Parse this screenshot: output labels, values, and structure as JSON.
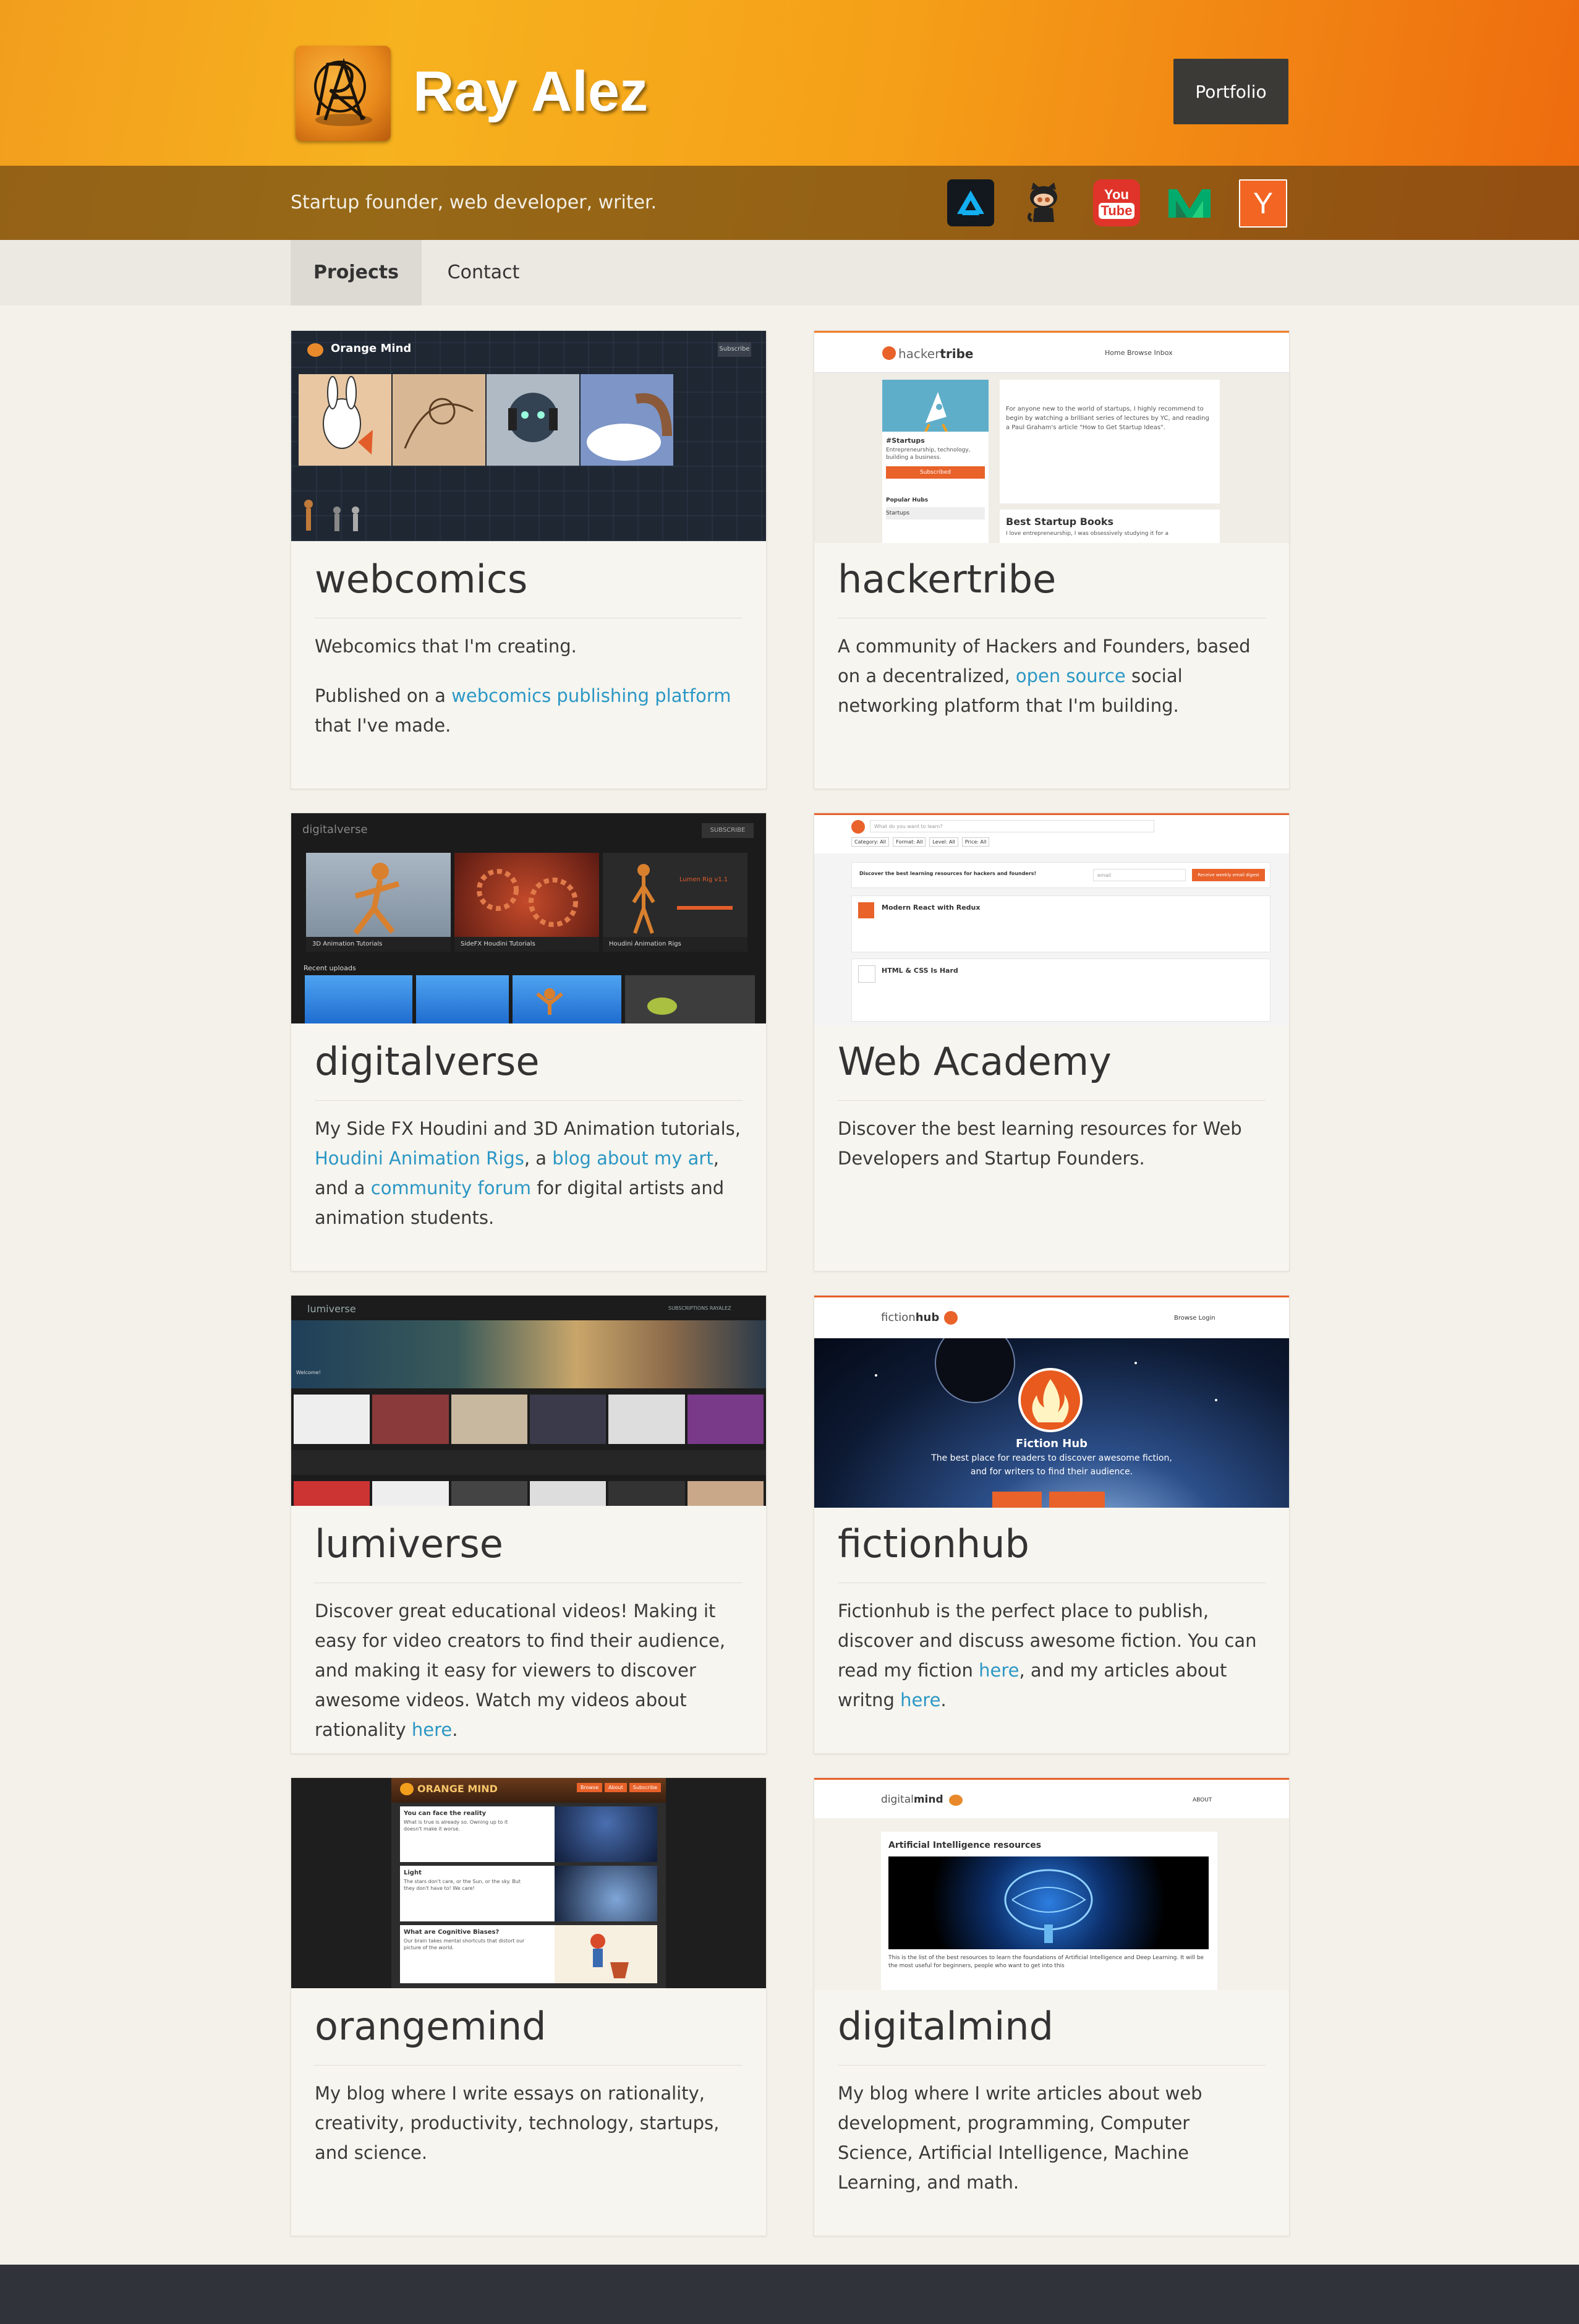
{
  "header": {
    "brand": "Ray Alez",
    "portfolio_label": "Portfolio",
    "tagline": "Startup founder, web developer, writer.",
    "social": [
      "artstation-icon",
      "github-icon",
      "youtube-icon",
      "medium-icon",
      "hacker-news-icon"
    ],
    "youtube_text": [
      "You",
      "Tube"
    ],
    "hn_letter": "Y"
  },
  "nav": {
    "projects": "Projects",
    "contact": "Contact"
  },
  "cards": {
    "webcomics": {
      "title": "webcomics",
      "p1": "Webcomics that I'm creating.",
      "p2_pre": "Published on a ",
      "p2_link": "webcomics publishing platform",
      "p2_post": " that I've made.",
      "shot": {
        "brand": "Orange Mind",
        "button": "Subscribe"
      }
    },
    "hackertribe": {
      "title": "hackertribe",
      "p1_pre": "A community of Hackers and Founders, based on a decentralized, ",
      "p1_link": "open source",
      "p1_post": " social networking platform that I'm building.",
      "shot": {
        "brand_a": "hacker",
        "brand_b": "tribe",
        "nav": "Home  Browse  Inbox",
        "hub": "#Startups",
        "hub_desc": "Entrepreneurship, technology, building a business.",
        "subscribe": "Subscribed",
        "popular": "Popular Hubs",
        "popular_item": "Startups",
        "post_title": "Best Startup Books",
        "post_text": "I love entrepreneurship, I was obsessively studying it for a",
        "intro": "For anyone new to the world of startups, I highly recommend to begin by watching a brilliant series of lectures by YC, and reading a Paul Graham's article \"How to Get Startup Ideas\"."
      }
    },
    "digitalverse": {
      "title": "digitalverse",
      "p1_pre": "My Side FX Houdini and 3D Animation tutorials, ",
      "link1": "Houdini Animation Rigs",
      "mid1": ", a ",
      "link2": "blog about my art",
      "mid2": ", and a ",
      "link3": "community forum",
      "p1_post": " for digital artists and animation students.",
      "shot": {
        "brand": "digitalverse",
        "button": "SUBSCRIBE",
        "thumbs": [
          "3D Animation Tutorials",
          "SideFX Houdini Tutorials",
          "Houdini Animation Rigs"
        ],
        "recent": "Recent uploads",
        "promo": "Lumen Rig v1.1"
      }
    },
    "webacademy": {
      "title": "Web Academy",
      "p1": "Discover the best learning resources for Web Developers and Startup Founders.",
      "shot": {
        "search": "What do you want to learn?",
        "filters": [
          "Category: All",
          "Format: All",
          "Level: All",
          "Price: All"
        ],
        "banner": "Discover the best learning resources for hackers and founders!",
        "email": "email",
        "cta": "Receive weekly email digest",
        "items": [
          "Modern React with Redux",
          "HTML & CSS Is Hard"
        ]
      }
    },
    "lumiverse": {
      "title": "lumiverse",
      "p1_pre": "Discover great educational videos! Making it easy for video creators to find their audience, and making it easy for viewers to discover awesome videos. Watch my videos about rationality ",
      "p1_link": "here",
      "p1_post": ".",
      "shot": {
        "brand": "lumiverse",
        "nav": "SUBSCRIPTIONS  RAYALEZ",
        "welcome": "Welcome!"
      }
    },
    "fictionhub": {
      "title": "fictionhub",
      "p1_pre": "Fictionhub is the perfect place to publish, discover and discuss awesome fiction. You can read my fiction ",
      "link1": "here",
      "mid": ", and my articles about writng ",
      "link2": "here",
      "p1_post": ".",
      "shot": {
        "brand_a": "fiction",
        "brand_b": "hub",
        "nav": "Browse  Login",
        "hero_title": "Fiction Hub",
        "hero_line1": "The best place for readers to discover awesome fiction,",
        "hero_line2": "and for writers to find their audience."
      }
    },
    "orangemind": {
      "title": "orangemind",
      "p1": "My blog where I write essays on rationality, creativity, productivity, technology, startups, and science.",
      "shot": {
        "brand": "ORANGE MIND",
        "buttons": [
          "Browse",
          "About",
          "Subscribe"
        ],
        "posts": [
          {
            "title": "You can face the reality",
            "text": "What is true is already so. Owning up to it doesn't make it worse."
          },
          {
            "title": "Light",
            "text": "The stars don't care, or the Sun, or the sky. But they don't have to! We care!"
          },
          {
            "title": "What are Cognitive Biases?",
            "text": "Our brain takes mental shortcuts that distort our picture of the world."
          }
        ]
      }
    },
    "digitalmind": {
      "title": "digitalmind",
      "p1": "My blog where I write articles about web development, programming, Computer Science, Artificial Intelligence, Machine Learning, and math.",
      "shot": {
        "brand_a": "digital",
        "brand_b": "mind",
        "nav": "ABOUT",
        "post_title": "Artificial Intelligence resources",
        "post_text": "This is the list of the best resources to learn the foundations of Artificial Intelligence and Deep Learning. It will be the most useful for beginners, people who want to get into this"
      }
    }
  },
  "colors": {
    "accent": "#f29e1d",
    "link": "#2b97c5",
    "dark_button": "#3b3a36",
    "footer": "#30333a"
  }
}
